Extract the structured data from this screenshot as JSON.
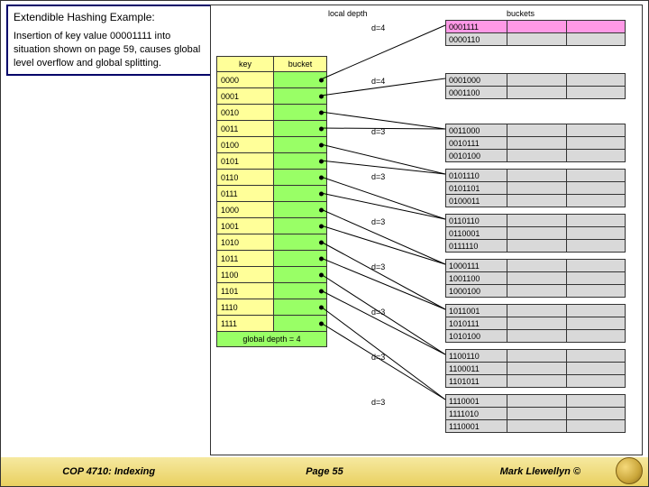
{
  "title": "Extendible Hashing Example:",
  "description": "Insertion of key value 00001111 into situation shown on page 59, causes global level overflow and global splitting.",
  "headers": {
    "local": "local depth",
    "buckets": "buckets"
  },
  "dir_header": {
    "key": "key",
    "bucket": "bucket"
  },
  "dir_keys": [
    "0000",
    "0001",
    "0010",
    "0011",
    "0100",
    "0101",
    "0110",
    "0111",
    "1000",
    "1001",
    "1010",
    "1011",
    "1100",
    "1101",
    "1110",
    "1111"
  ],
  "global_depth_label": "global depth = 4",
  "depth_top1": "d=4",
  "depth_top2": "d=4",
  "depths": [
    "d=3",
    "d=3",
    "d=3",
    "d=3",
    "d=3",
    "d=3",
    "d=3"
  ],
  "bucket_top1": [
    "0001111",
    "0000110"
  ],
  "bucket_top2": [
    "0001000",
    "0001100"
  ],
  "buckets_main": [
    [
      "0011000",
      "0010111",
      "0010100"
    ],
    [
      "0101110",
      "0101101",
      "0100011"
    ],
    [
      "0110110",
      "0110001",
      "0111110"
    ],
    [
      "1000111",
      "1001100",
      "1000100"
    ],
    [
      "1011001",
      "1010111",
      "1010100"
    ],
    [
      "1100110",
      "1100011",
      "1101011"
    ],
    [
      "1110001",
      "1111010",
      "1110001"
    ]
  ],
  "footer": {
    "course": "COP 4710: Indexing",
    "page": "Page 55",
    "author": "Mark Llewellyn ©"
  }
}
